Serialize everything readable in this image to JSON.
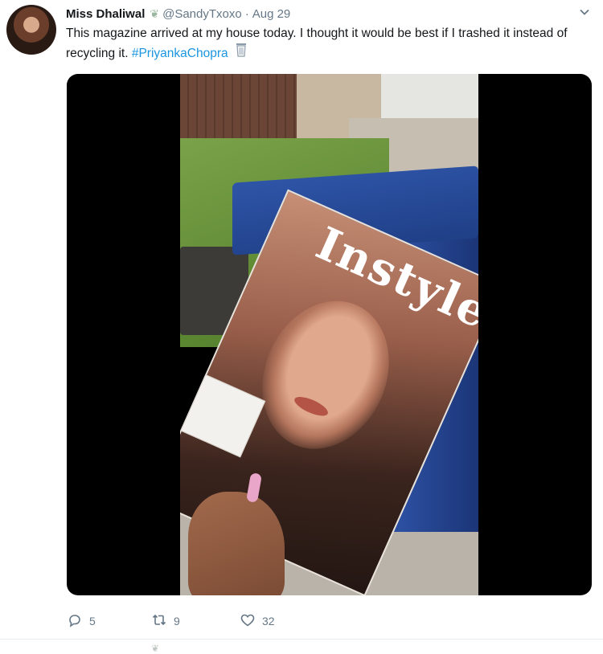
{
  "tweet": {
    "author": {
      "display_name": "Miss Dhaliwal",
      "badge_icon": "hummingbird-emoji",
      "handle": "@SandyTxoxo",
      "separator": "·",
      "date": "Aug 29"
    },
    "menu_caret_icon": "chevron-down-icon",
    "text_before_hashtag": "This magazine arrived at my house today. I thought it would be best if I trashed it instead of recycling it.",
    "hashtag": "#PriyankaChopra",
    "emoji_icon": "wastebasket-emoji",
    "media": {
      "magazine_title": "Instyle"
    },
    "actions": {
      "reply": {
        "icon": "reply-icon",
        "count": "5"
      },
      "retweet": {
        "icon": "retweet-icon",
        "count": "9"
      },
      "like": {
        "icon": "heart-icon",
        "count": "32"
      }
    }
  },
  "colors": {
    "link": "#1b95e0",
    "secondary_text": "#657786",
    "primary_text": "#14171a"
  }
}
